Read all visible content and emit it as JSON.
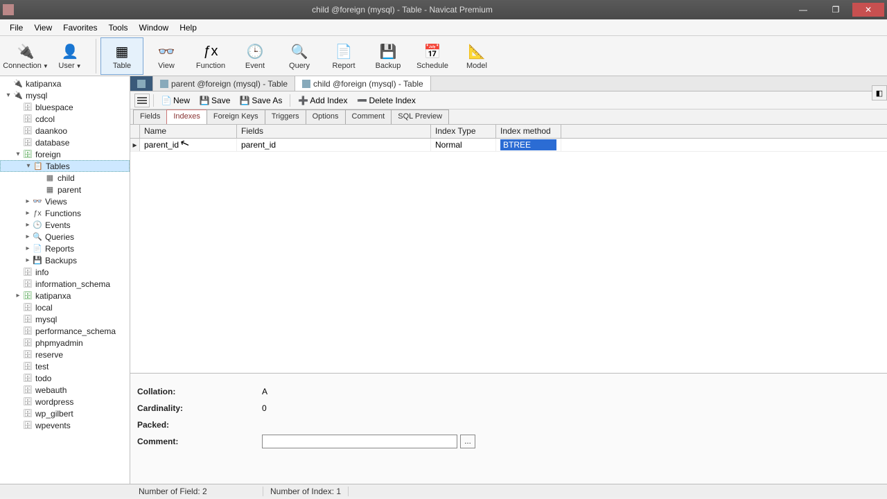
{
  "title": "child @foreign (mysql) - Table - Navicat Premium",
  "menu": [
    "File",
    "View",
    "Favorites",
    "Tools",
    "Window",
    "Help"
  ],
  "toolbar": [
    {
      "label": "Connection",
      "icon": "🔌"
    },
    {
      "label": "User",
      "icon": "👤"
    },
    {
      "label": "Table",
      "icon": "▦",
      "active": true
    },
    {
      "label": "View",
      "icon": "👓"
    },
    {
      "label": "Function",
      "icon": "ƒx"
    },
    {
      "label": "Event",
      "icon": "🕒"
    },
    {
      "label": "Query",
      "icon": "🔍"
    },
    {
      "label": "Report",
      "icon": "📄"
    },
    {
      "label": "Backup",
      "icon": "💾"
    },
    {
      "label": "Schedule",
      "icon": "📅"
    },
    {
      "label": "Model",
      "icon": "📐"
    }
  ],
  "tree": [
    {
      "ind": 0,
      "toggle": "",
      "icon": "🔌",
      "label": "katipanxa",
      "color": "#aa8844"
    },
    {
      "ind": 0,
      "toggle": "▾",
      "icon": "🔌",
      "label": "mysql",
      "color": "#3a9a3a"
    },
    {
      "ind": 1,
      "toggle": "",
      "icon": "🗄",
      "label": "bluespace",
      "color": "#888"
    },
    {
      "ind": 1,
      "toggle": "",
      "icon": "🗄",
      "label": "cdcol",
      "color": "#888"
    },
    {
      "ind": 1,
      "toggle": "",
      "icon": "🗄",
      "label": "daankoo",
      "color": "#888"
    },
    {
      "ind": 1,
      "toggle": "",
      "icon": "🗄",
      "label": "database",
      "color": "#888"
    },
    {
      "ind": 1,
      "toggle": "▾",
      "icon": "🗄",
      "label": "foreign",
      "color": "#3a9a3a"
    },
    {
      "ind": 2,
      "toggle": "▾",
      "icon": "📋",
      "label": "Tables",
      "color": "#555",
      "selected": true
    },
    {
      "ind": 3,
      "toggle": "",
      "icon": "▦",
      "label": "child",
      "color": "#555"
    },
    {
      "ind": 3,
      "toggle": "",
      "icon": "▦",
      "label": "parent",
      "color": "#555"
    },
    {
      "ind": 2,
      "toggle": "▸",
      "icon": "👓",
      "label": "Views",
      "color": "#555"
    },
    {
      "ind": 2,
      "toggle": "▸",
      "icon": "ƒx",
      "label": "Functions",
      "color": "#555"
    },
    {
      "ind": 2,
      "toggle": "▸",
      "icon": "🕒",
      "label": "Events",
      "color": "#555"
    },
    {
      "ind": 2,
      "toggle": "▸",
      "icon": "🔍",
      "label": "Queries",
      "color": "#555"
    },
    {
      "ind": 2,
      "toggle": "▸",
      "icon": "📄",
      "label": "Reports",
      "color": "#555"
    },
    {
      "ind": 2,
      "toggle": "▸",
      "icon": "💾",
      "label": "Backups",
      "color": "#555"
    },
    {
      "ind": 1,
      "toggle": "",
      "icon": "🗄",
      "label": "info",
      "color": "#888"
    },
    {
      "ind": 1,
      "toggle": "",
      "icon": "🗄",
      "label": "information_schema",
      "color": "#888"
    },
    {
      "ind": 1,
      "toggle": "▸",
      "icon": "🗄",
      "label": "katipanxa",
      "color": "#3a9a3a"
    },
    {
      "ind": 1,
      "toggle": "",
      "icon": "🗄",
      "label": "local",
      "color": "#888"
    },
    {
      "ind": 1,
      "toggle": "",
      "icon": "🗄",
      "label": "mysql",
      "color": "#888"
    },
    {
      "ind": 1,
      "toggle": "",
      "icon": "🗄",
      "label": "performance_schema",
      "color": "#888"
    },
    {
      "ind": 1,
      "toggle": "",
      "icon": "🗄",
      "label": "phpmyadmin",
      "color": "#888"
    },
    {
      "ind": 1,
      "toggle": "",
      "icon": "🗄",
      "label": "reserve",
      "color": "#888"
    },
    {
      "ind": 1,
      "toggle": "",
      "icon": "🗄",
      "label": "test",
      "color": "#888"
    },
    {
      "ind": 1,
      "toggle": "",
      "icon": "🗄",
      "label": "todo",
      "color": "#888"
    },
    {
      "ind": 1,
      "toggle": "",
      "icon": "🗄",
      "label": "webauth",
      "color": "#888"
    },
    {
      "ind": 1,
      "toggle": "",
      "icon": "🗄",
      "label": "wordpress",
      "color": "#888"
    },
    {
      "ind": 1,
      "toggle": "",
      "icon": "🗄",
      "label": "wp_gilbert",
      "color": "#888"
    },
    {
      "ind": 1,
      "toggle": "",
      "icon": "🗄",
      "label": "wpevents",
      "color": "#888"
    }
  ],
  "doc_tabs": [
    {
      "label": "",
      "dark": true
    },
    {
      "label": "parent @foreign (mysql) - Table"
    },
    {
      "label": "child @foreign (mysql) - Table",
      "active": true
    }
  ],
  "sub_toolbar": {
    "new": "New",
    "save": "Save",
    "saveas": "Save As",
    "addindex": "Add Index",
    "delindex": "Delete Index"
  },
  "designer_tabs": [
    "Fields",
    "Indexes",
    "Foreign Keys",
    "Triggers",
    "Options",
    "Comment",
    "SQL Preview"
  ],
  "designer_active": 1,
  "grid": {
    "headers": {
      "name": "Name",
      "fields": "Fields",
      "type": "Index Type",
      "method": "Index method"
    },
    "rows": [
      {
        "name": "parent_id",
        "fields": "parent_id",
        "type": "Normal",
        "method": "BTREE"
      }
    ]
  },
  "details": {
    "collation_label": "Collation:",
    "collation": "A",
    "cardinality_label": "Cardinality:",
    "cardinality": "0",
    "packed_label": "Packed:",
    "packed": "",
    "comment_label": "Comment:",
    "comment": ""
  },
  "status": {
    "fields": "Number of Field: 2",
    "index": "Number of Index: 1"
  }
}
